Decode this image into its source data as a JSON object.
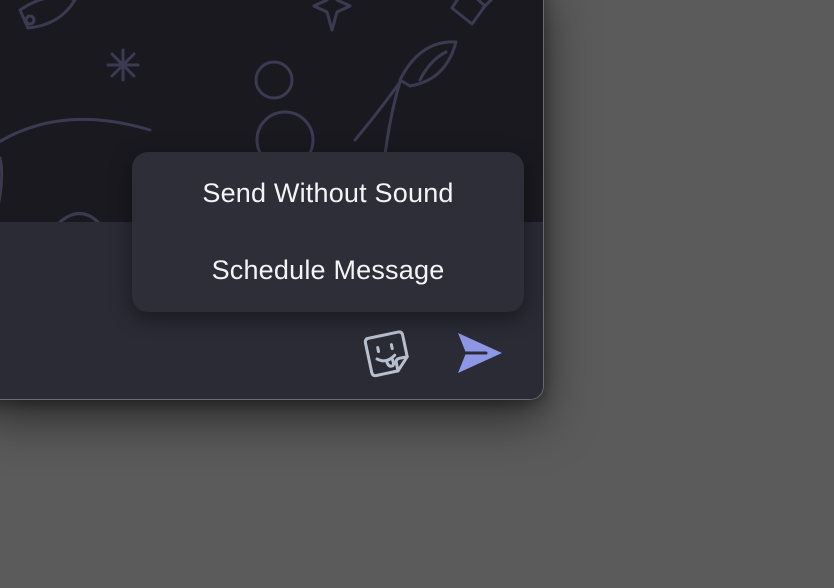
{
  "send_menu": {
    "items": [
      {
        "label": "Send Without Sound"
      },
      {
        "label": "Schedule Message"
      }
    ]
  },
  "composer": {
    "sticker_icon": "smiley-sticker-icon",
    "send_icon": "paper-plane-send-icon"
  },
  "colors": {
    "desktop": "#5b5b5b",
    "wallpaper": "#1a1920",
    "wallpaper_doodles": "#3b3a52",
    "composer_bar": "#2b2b36",
    "menu_background": "#2e2e39",
    "menu_text": "#f4f4f7",
    "sticker_icon": "#b8c0d0",
    "send_accent": "#8e97e6"
  }
}
